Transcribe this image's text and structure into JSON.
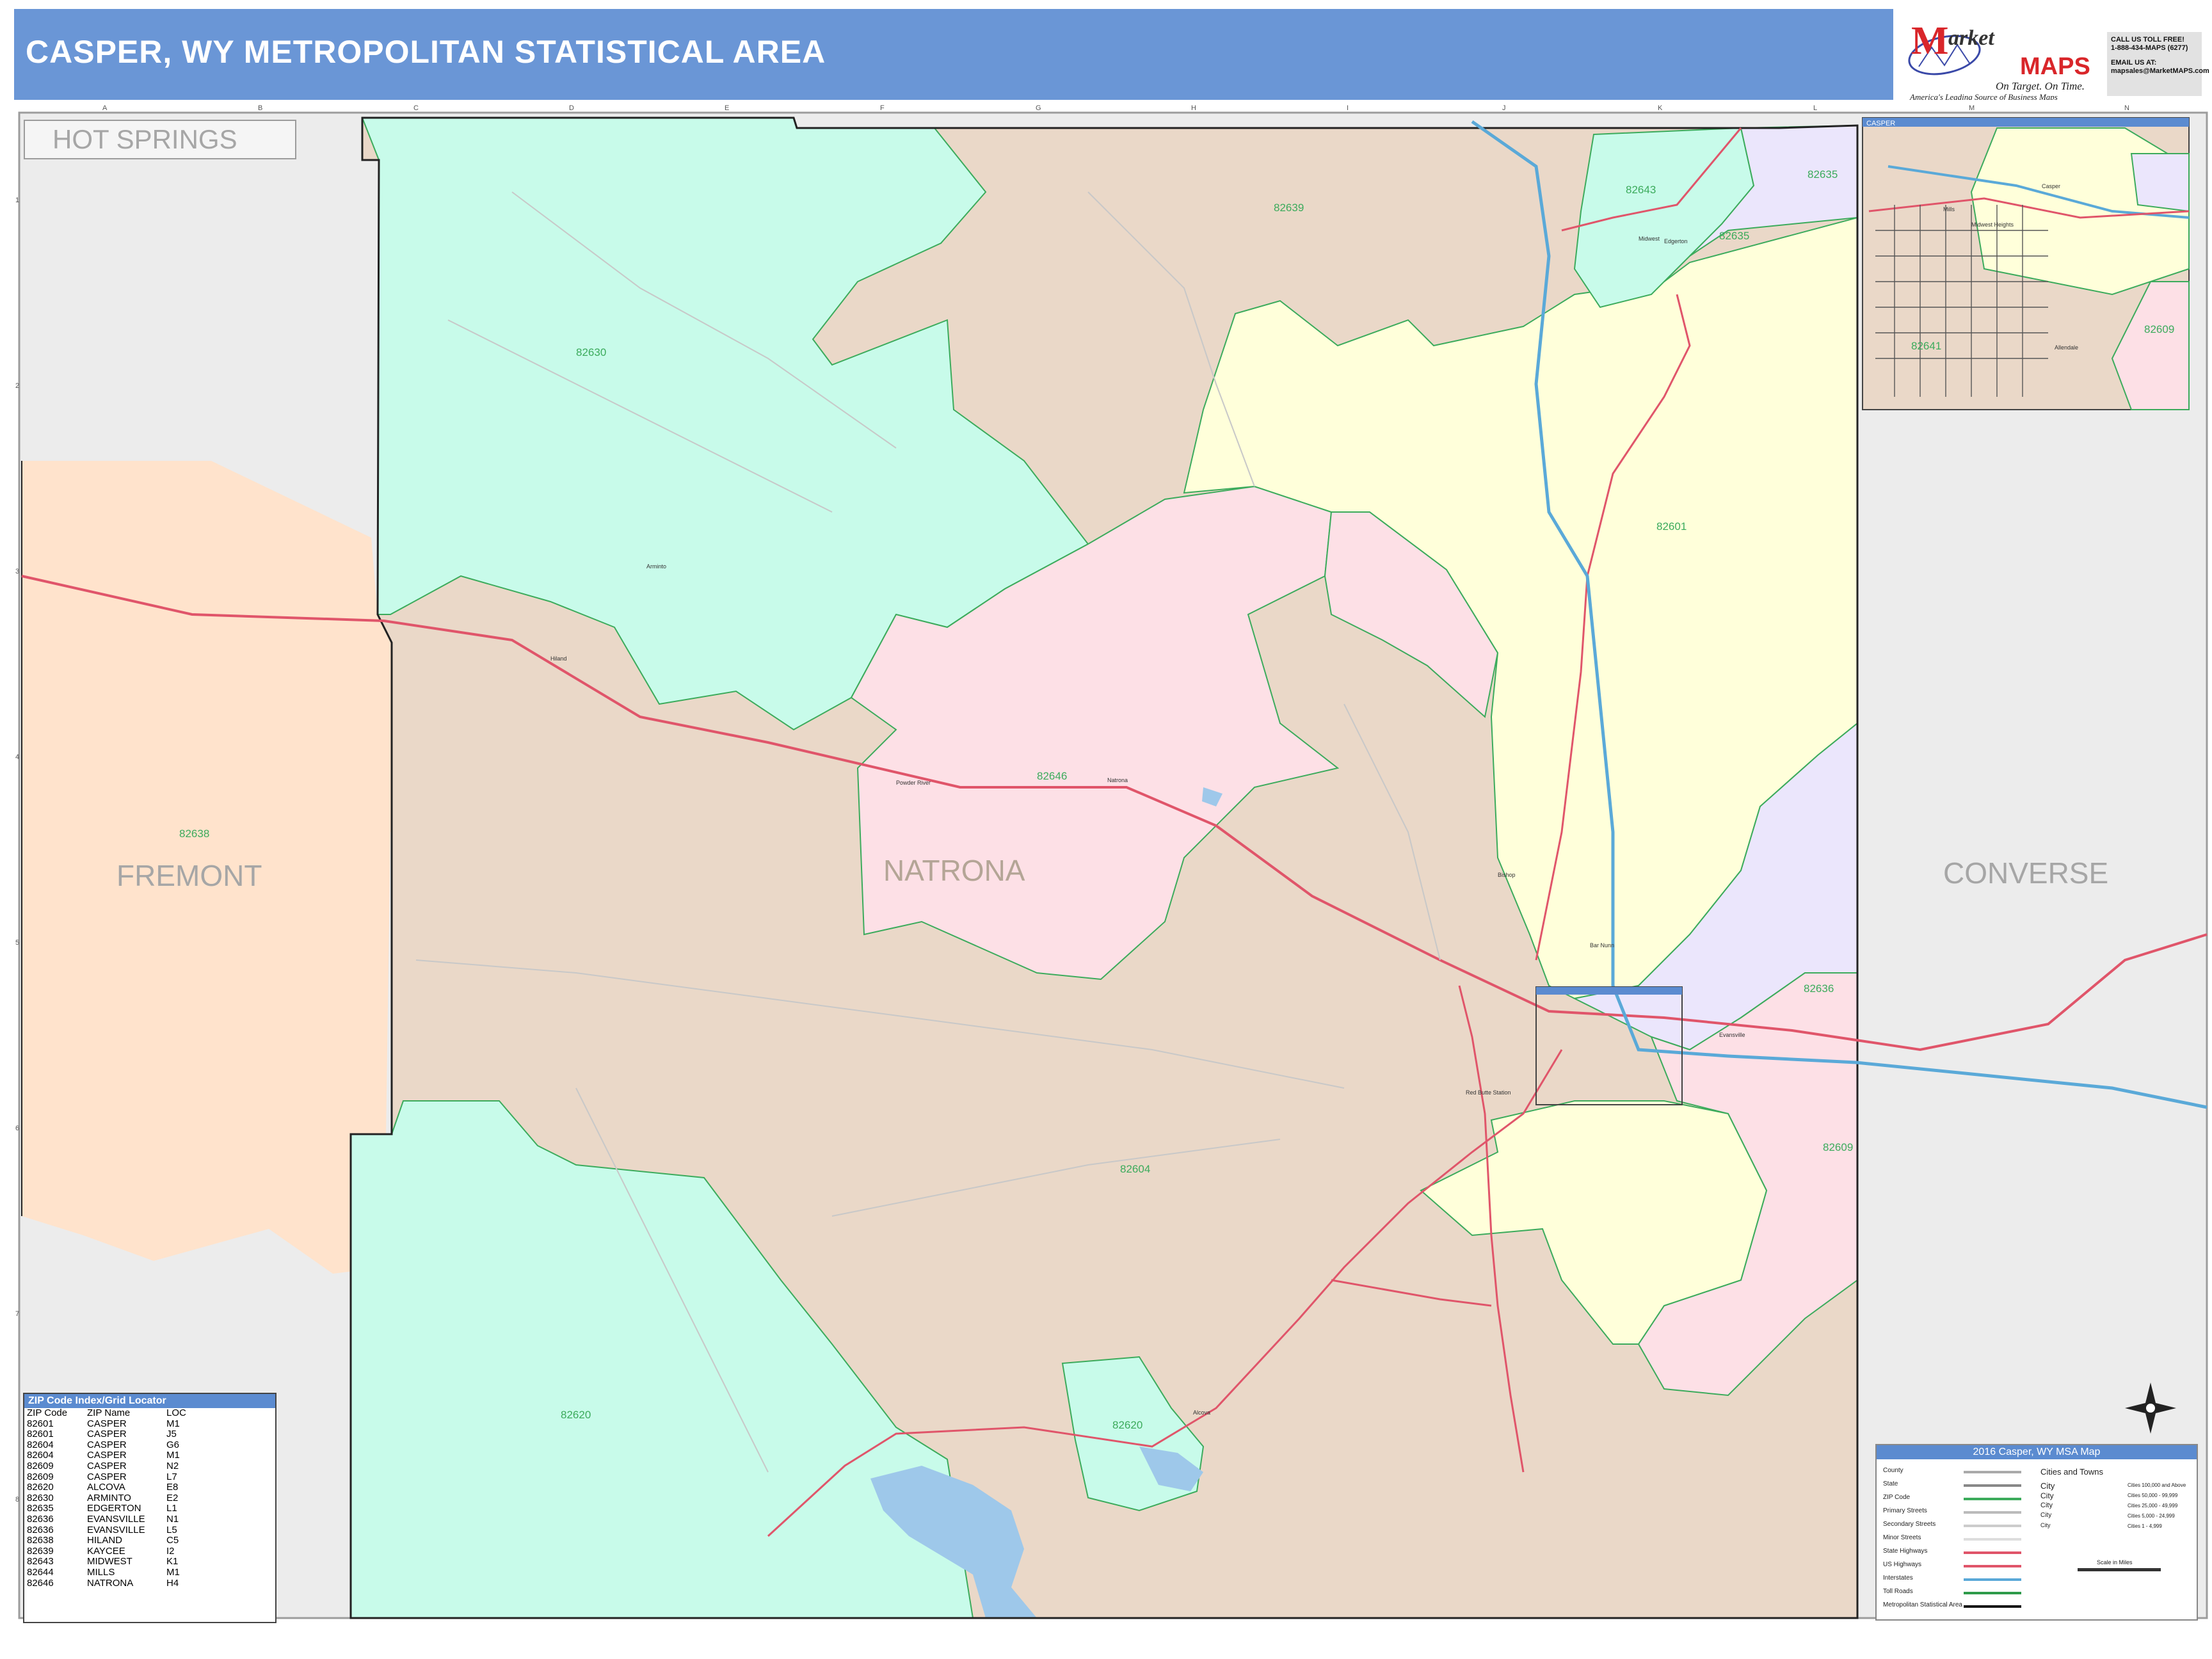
{
  "title": "CASPER, WY METROPOLITAN STATISTICAL AREA",
  "logo": {
    "brand_m": "M",
    "brand_arket": "arket",
    "brand_maps": "MAPS",
    "tagline": "On Target. On Time.",
    "subline": "America's Leading Source of Business Maps"
  },
  "contact": {
    "line1": "CALL US TOLL FREE!",
    "line2": "1-888-434-MAPS (6277)",
    "line3": "EMAIL US AT:",
    "line4": "mapsales@MarketMAPS.com"
  },
  "grid": {
    "columns": [
      "A",
      "B",
      "C",
      "D",
      "E",
      "F",
      "G",
      "H",
      "I",
      "J",
      "K",
      "L",
      "M",
      "N"
    ],
    "rows": [
      "1",
      "2",
      "3",
      "4",
      "5",
      "6",
      "7",
      "8"
    ]
  },
  "counties": {
    "hot_springs": "HOT SPRINGS",
    "fremont": "FREMONT",
    "natrona": "NATRONA",
    "converse": "CONVERSE"
  },
  "zip_labels": {
    "z82639": "82639",
    "z82630": "82630",
    "z82643": "82643",
    "z82635a": "82635",
    "z82635b": "82635",
    "z82601": "82601",
    "z82638": "82638",
    "z82646": "82646",
    "z82636": "82636",
    "z82609a": "82609",
    "z82609b": "82609",
    "z82604": "82604",
    "z82620a": "82620",
    "z82620b": "82620",
    "z82641": "82641"
  },
  "places": {
    "edgerton": "Edgerton",
    "midwest": "Midwest",
    "powder_river": "Powder River",
    "natrona_town": "Natrona",
    "hiland": "Hiland",
    "bar_nunn": "Bar Nunn",
    "bishop": "Bishop",
    "evansville": "Evansville",
    "red_butte": "Red Butte Station",
    "alcova": "Alcova",
    "arminto": "Arminto",
    "casper_inset": "Casper",
    "midwest_heights": "Midwest Heights",
    "allendale": "Allendale",
    "mills": "Mills"
  },
  "inset": {
    "title": "CASPER"
  },
  "zip_index": {
    "header": "ZIP Code Index/Grid Locator",
    "col_zip": "ZIP Code",
    "col_name": "ZIP Name",
    "col_loc": "LOC",
    "rows": [
      {
        "zip": "82601",
        "name": "CASPER",
        "loc": "M1"
      },
      {
        "zip": "82601",
        "name": "CASPER",
        "loc": "J5"
      },
      {
        "zip": "82604",
        "name": "CASPER",
        "loc": "G6"
      },
      {
        "zip": "82604",
        "name": "CASPER",
        "loc": "M1"
      },
      {
        "zip": "82609",
        "name": "CASPER",
        "loc": "N2"
      },
      {
        "zip": "82609",
        "name": "CASPER",
        "loc": "L7"
      },
      {
        "zip": "82620",
        "name": "ALCOVA",
        "loc": "E8"
      },
      {
        "zip": "82630",
        "name": "ARMINTO",
        "loc": "E2"
      },
      {
        "zip": "82635",
        "name": "EDGERTON",
        "loc": "L1"
      },
      {
        "zip": "82636",
        "name": "EVANSVILLE",
        "loc": "N1"
      },
      {
        "zip": "82636",
        "name": "EVANSVILLE",
        "loc": "L5"
      },
      {
        "zip": "82638",
        "name": "HILAND",
        "loc": "C5"
      },
      {
        "zip": "82639",
        "name": "KAYCEE",
        "loc": "I2"
      },
      {
        "zip": "82643",
        "name": "MIDWEST",
        "loc": "K1"
      },
      {
        "zip": "82644",
        "name": "MILLS",
        "loc": "M1"
      },
      {
        "zip": "82646",
        "name": "NATRONA",
        "loc": "H4"
      }
    ]
  },
  "legend": {
    "title": "2016 Casper, WY MSA Map",
    "items": [
      "County",
      "State",
      "ZIP Code",
      "Primary Streets",
      "Secondary Streets",
      "Minor Streets",
      "State Highways",
      "US Highways",
      "Interstates",
      "Toll Roads",
      "Metropolitan Statistical Area"
    ],
    "cities_header": "Cities and Towns",
    "cities": [
      {
        "name": "City",
        "desc": "Cities 100,000 and Above"
      },
      {
        "name": "City",
        "desc": "Cities 50,000 - 99,999"
      },
      {
        "name": "City",
        "desc": "Cities 25,000 - 49,999"
      },
      {
        "name": "City",
        "desc": "Cities 5,000 - 24,999"
      },
      {
        "name": "City",
        "desc": "Cities 1 - 4,999"
      }
    ],
    "scale_label": "Scale in Miles"
  },
  "colors": {
    "title_bar": "#6a96d6",
    "outside_gray": "#ececec",
    "tan": "#ead8c8",
    "mint": "#c8fbea",
    "pink": "#fde0e6",
    "yellow": "#ffffda",
    "lavender": "#ebe6fc",
    "peach": "#ffe3cc",
    "zip_border": "#3cab5c",
    "state_hwy": "#e0556a",
    "interstate": "#5aa9d8",
    "water": "#9ec8ea"
  }
}
